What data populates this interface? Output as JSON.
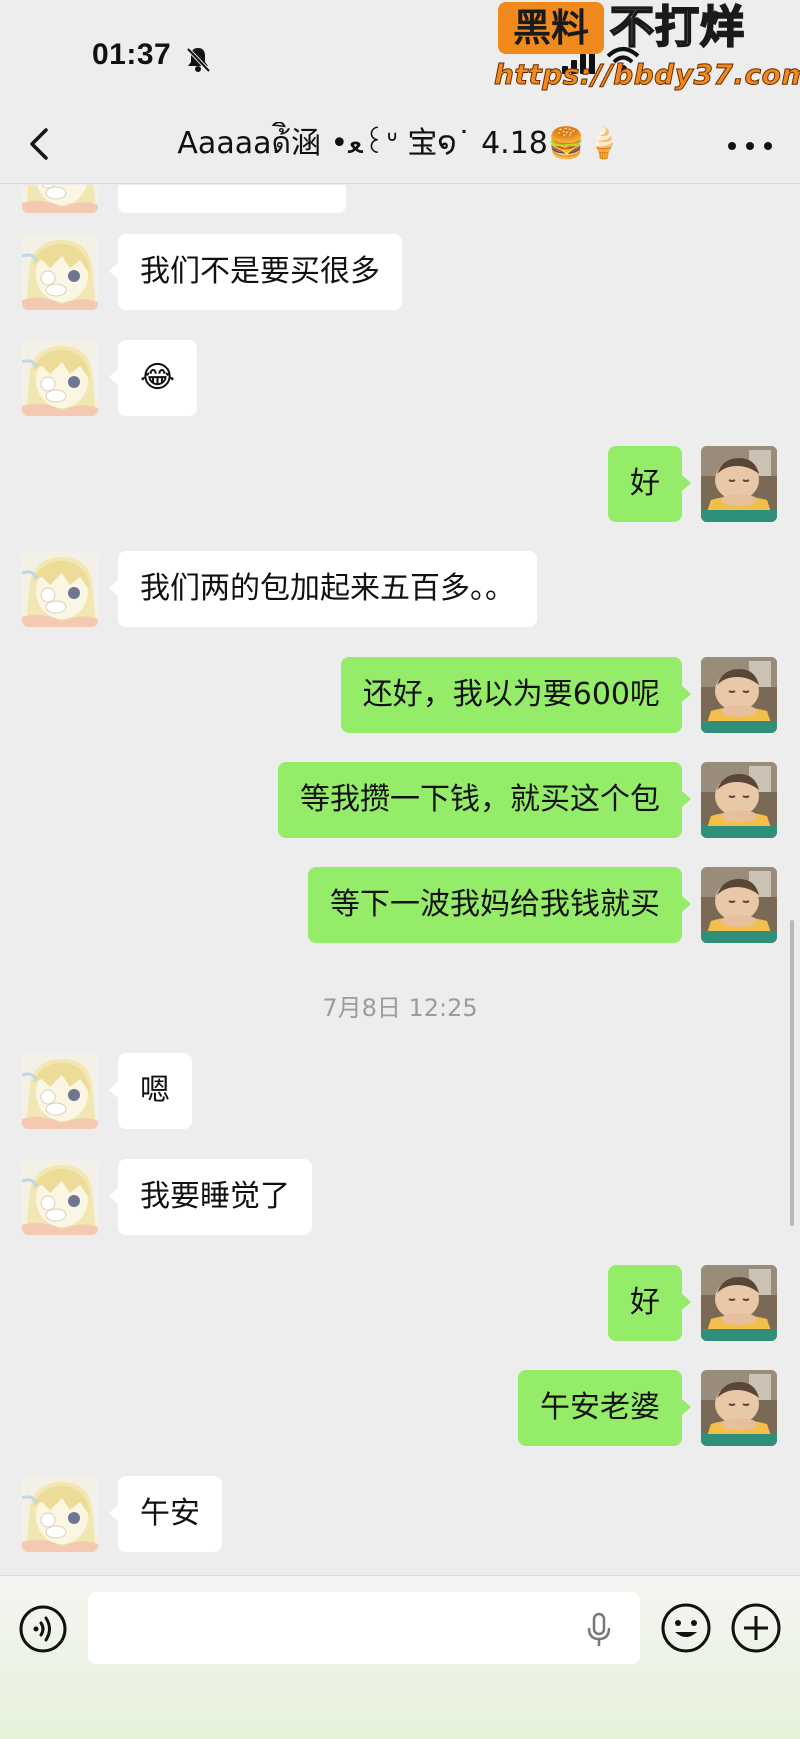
{
  "status_bar": {
    "time": "01:37"
  },
  "watermark": {
    "badge": "黑料",
    "title": "不打烊",
    "url": "https://bbdy37.com"
  },
  "nav": {
    "title": "Aaaaaด้ิ涵 •ﻌ꒰ᐡ 宝໑˙ 4.18🍔🍦"
  },
  "messages": [
    {
      "side": "left",
      "text": "我们不是要买很多"
    },
    {
      "side": "left",
      "text": "😂"
    },
    {
      "side": "right",
      "text": "好"
    },
    {
      "side": "left",
      "text": "我们两的包加起来五百多。。"
    },
    {
      "side": "right",
      "text": "还好，我以为要600呢"
    },
    {
      "side": "right",
      "text": "等我攒一下钱，就买这个包"
    },
    {
      "side": "right",
      "text": "等下一波我妈给我钱就买"
    },
    {
      "side": "left",
      "text": "嗯"
    },
    {
      "side": "left",
      "text": "我要睡觉了"
    },
    {
      "side": "right",
      "text": "好"
    },
    {
      "side": "right",
      "text": "午安老婆"
    },
    {
      "side": "left",
      "text": "午安"
    }
  ],
  "time_divider": "7月8日 12:25",
  "input": {
    "value": "",
    "placeholder": ""
  },
  "colors": {
    "background": "#ededed",
    "self_bubble": "#95ec69",
    "other_bubble": "#ffffff",
    "watermark_orange": "#f08a1c"
  },
  "icons": {
    "back": "chevron-left-icon",
    "more": "more-dots-icon",
    "voice": "voice-mode-icon",
    "mic": "microphone-icon",
    "emoji": "emoji-icon",
    "plus": "plus-icon"
  }
}
